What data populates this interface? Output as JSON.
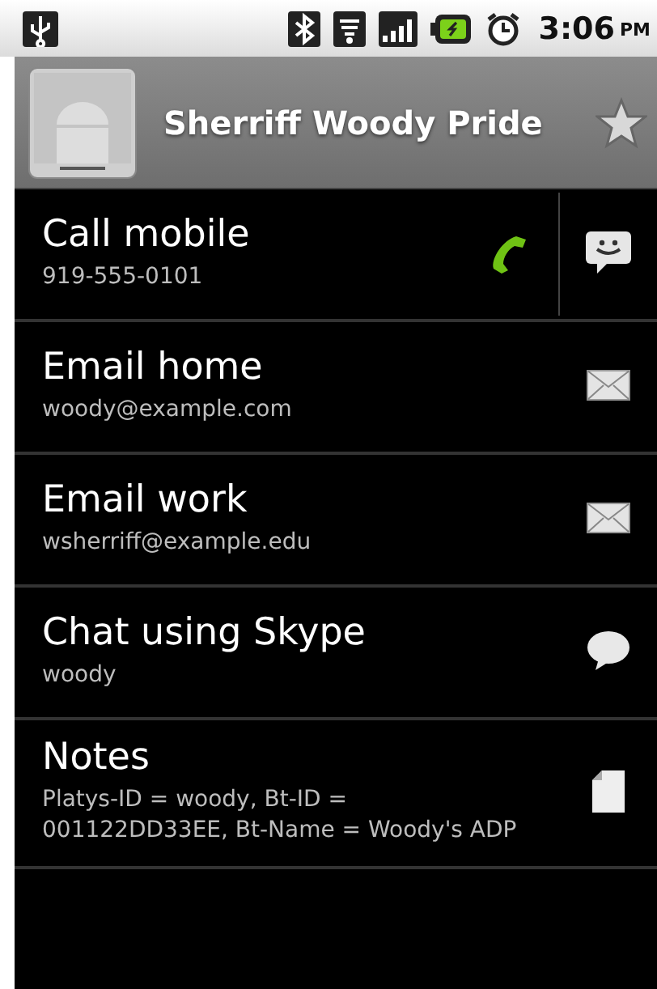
{
  "status_bar": {
    "time": "3:06",
    "ampm": "PM"
  },
  "header": {
    "name": "Sherriff Woody Pride",
    "starred": false
  },
  "rows": [
    {
      "kind": "call",
      "title": "Call mobile",
      "detail": "919-555-0101"
    },
    {
      "kind": "email",
      "title": "Email home",
      "detail": "woody@example.com"
    },
    {
      "kind": "email",
      "title": "Email work",
      "detail": "wsherriff@example.edu"
    },
    {
      "kind": "chat",
      "title": "Chat using Skype",
      "detail": "woody"
    },
    {
      "kind": "note",
      "title": "Notes",
      "detail": "Platys-ID = woody, Bt-ID = 001122DD33EE, Bt-Name = Woody's ADP"
    }
  ]
}
